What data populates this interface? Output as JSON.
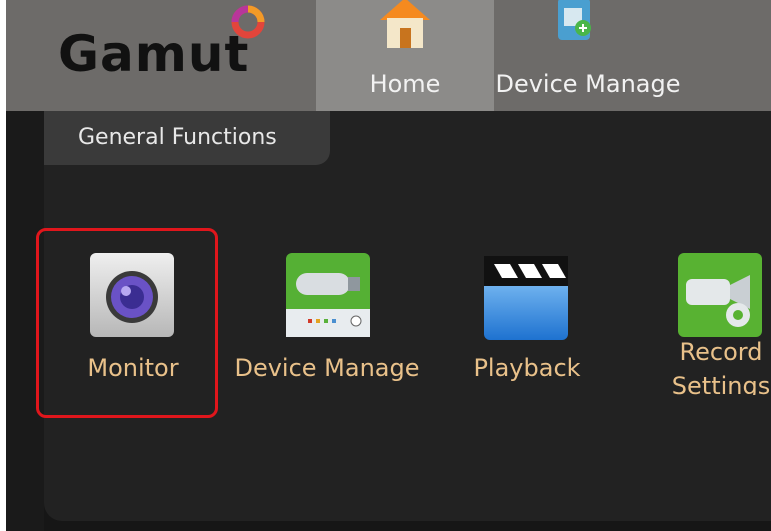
{
  "header": {
    "logo_text": "Gamut",
    "tabs": [
      {
        "label": "Home",
        "icon": "house-icon"
      },
      {
        "label": "Device Manage",
        "icon": "device-add-icon"
      }
    ]
  },
  "panel": {
    "section_title": "General Functions",
    "functions": [
      {
        "label": "Monitor",
        "icon": "camera-lens-icon"
      },
      {
        "label": "Device Manage",
        "icon": "device-manage-icon"
      },
      {
        "label": "Playback",
        "icon": "clapperboard-icon"
      },
      {
        "label_line1": "Record",
        "label_line2": "Settings",
        "icon": "record-settings-icon"
      }
    ]
  },
  "colors": {
    "accent_label": "#e9c18a",
    "highlight": "#e0161c",
    "header_bg": "#6d6b69",
    "active_tab_bg": "#8c8b89"
  }
}
